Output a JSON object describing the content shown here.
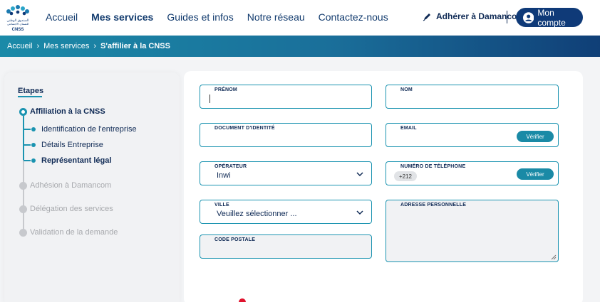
{
  "logo": {
    "line1": "الصندوق الوطني",
    "line2": "للضمان الاجتماعي",
    "line3": "CNSS"
  },
  "nav": {
    "items": [
      {
        "label": "Accueil"
      },
      {
        "label": "Mes services"
      },
      {
        "label": "Guides et infos"
      },
      {
        "label": "Notre réseau"
      },
      {
        "label": "Contactez-nous"
      }
    ],
    "adherer_label": "Adhérer à Damancom",
    "account_label": "Mon compte"
  },
  "breadcrumb": {
    "items": [
      "Accueil",
      "Mes services"
    ],
    "current": "S'affilier à la CNSS"
  },
  "steps": {
    "title": "Etapes",
    "main": [
      {
        "label": "Affiliation à la CNSS",
        "state": "active"
      },
      {
        "label": "Adhésion à Damancom",
        "state": "inactive"
      },
      {
        "label": "Délégation des services",
        "state": "inactive"
      },
      {
        "label": "Validation de la demande",
        "state": "inactive"
      }
    ],
    "sub": [
      {
        "label": "Identification de l'entreprise"
      },
      {
        "label": "Détails Entreprise"
      },
      {
        "label": "Représentant légal"
      }
    ]
  },
  "form": {
    "prenom": {
      "label": "PRÉNOM",
      "value": ""
    },
    "nom": {
      "label": "NOM",
      "value": ""
    },
    "document": {
      "label": "DOCUMENT D'IDENTITÉ",
      "value": ""
    },
    "email": {
      "label": "EMAIL",
      "value": "",
      "verify_label": "Vérifier"
    },
    "operateur": {
      "label": "OPÉRATEUR",
      "value": "Inwi"
    },
    "telephone": {
      "label": "NUMÉRO DE TÉLÉPHONE",
      "prefix": "+212",
      "verify_label": "Vérifier"
    },
    "ville": {
      "label": "VILLE",
      "value": "Veuillez sélectionner ..."
    },
    "adresse": {
      "label": "ADRESSE PERSONNELLE",
      "value": ""
    },
    "code_postale": {
      "label": "CODE POSTALE",
      "value": ""
    }
  },
  "colors": {
    "accent": "#1a93b0",
    "brand_dark": "#0f3a78",
    "record": "#e0132e"
  }
}
